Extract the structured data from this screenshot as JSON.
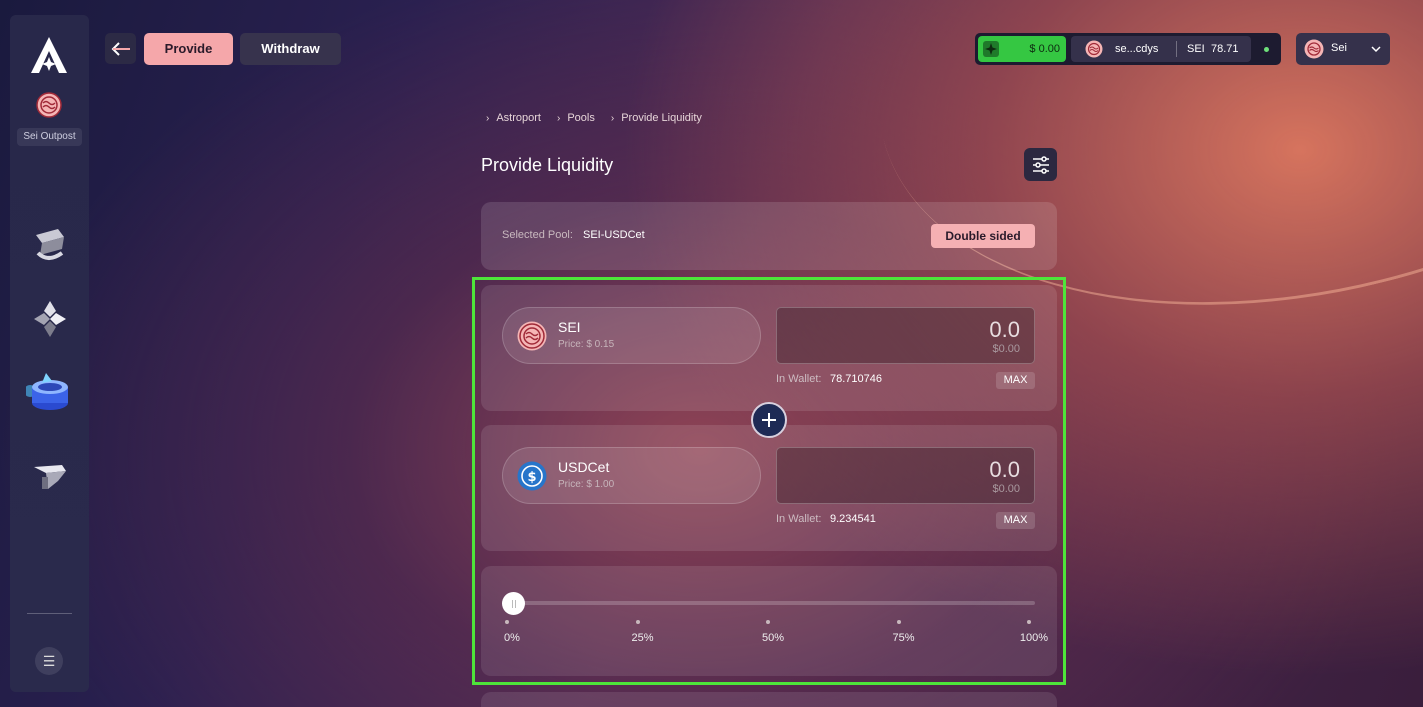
{
  "sidebar": {
    "logo_icon": "astroport-logo-icon",
    "chain_icon": "sei-icon",
    "outpost_label": "Sei Outpost",
    "nav_icons": [
      "swap-nav-icon",
      "pools-nav-icon",
      "liquidity-nav-icon",
      "bridge-nav-icon"
    ],
    "menu_icon": "hamburger-menu-icon"
  },
  "header": {
    "tabs": {
      "provide": "Provide",
      "withdraw": "Withdraw"
    },
    "wallet": {
      "usd_balance": "$ 0.00",
      "address": "se...cdys",
      "token": "SEI",
      "balance": "78.71",
      "status_color": "#6ee07a"
    },
    "network": {
      "label": "Sei"
    }
  },
  "breadcrumb": [
    "Astroport",
    "Pools",
    "Provide Liquidity"
  ],
  "page": {
    "title": "Provide Liquidity"
  },
  "pool": {
    "label": "Selected Pool:",
    "value": "SEI-USDCet",
    "mode_button": "Double sided"
  },
  "tokens": [
    {
      "symbol": "SEI",
      "price": "Price: $ 0.15",
      "amount": "0.0",
      "usd": "$0.00",
      "wallet_label": "In Wallet:",
      "wallet_balance": "78.710746",
      "max_label": "MAX",
      "icon": "sei-token-icon"
    },
    {
      "symbol": "USDCet",
      "price": "Price: $ 1.00",
      "amount": "0.0",
      "usd": "$0.00",
      "wallet_label": "In Wallet:",
      "wallet_balance": "9.234541",
      "max_label": "MAX",
      "icon": "usdc-token-icon"
    }
  ],
  "slider": {
    "value_percent": 0,
    "ticks": [
      "0%",
      "25%",
      "50%",
      "75%",
      "100%"
    ]
  },
  "colors": {
    "accent_pink": "#f5a7aa",
    "highlight_green": "#4ee53a",
    "wallet_green": "#35c742"
  }
}
